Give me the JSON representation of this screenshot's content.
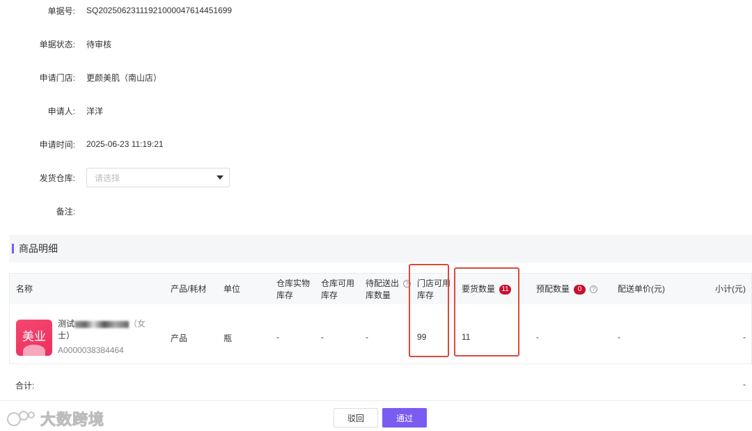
{
  "form": {
    "order_no_label": "单据号:",
    "order_no": "SQ2025062311192100004761445​1699",
    "status_label": "单据状态:",
    "status": "待审核",
    "store_label": "申请门店:",
    "store": "更颜美肌（南山店）",
    "applicant_label": "申请人:",
    "applicant": "洋洋",
    "apply_time_label": "申请时间:",
    "apply_time": "2025-06-23 11:19:21",
    "warehouse_label": "发货仓库:",
    "warehouse_placeholder": "请选择",
    "remark_label": "备注:"
  },
  "section": {
    "title": "商品明细"
  },
  "table": {
    "headers": {
      "name": "名称",
      "type": "产品/耗材",
      "unit": "单位",
      "wh_physical_1": "仓库实物",
      "wh_physical_2": "库存",
      "wh_available_1": "仓库可用",
      "wh_available_2": "库存",
      "pending_1": "待配送出",
      "pending_2": "库数量",
      "store_available_1": "门店可用",
      "store_available_2": "库存",
      "request_qty": "要货数量",
      "request_qty_badge": "11",
      "prealloc_qty": "预配数量",
      "prealloc_badge": "0",
      "unit_price": "配送单价(元)",
      "subtotal": "小计(元)"
    },
    "rows": [
      {
        "thumb_text": "美业",
        "name_prefix": "测试",
        "name_suffix": "（女",
        "name_line2": "士）",
        "code": "A0000038384464",
        "type": "产品",
        "unit": "瓶",
        "wh_physical": "-",
        "wh_available": "-",
        "pending": "-",
        "store_available": "99",
        "request_qty": "11",
        "prealloc_qty": "-",
        "unit_price": "-",
        "subtotal": "-"
      }
    ]
  },
  "total": {
    "label": "合计:",
    "value": "-"
  },
  "footer": {
    "reject_label": "驳回",
    "pass_label": "通过"
  },
  "watermark": {
    "text": "大数跨境"
  },
  "colors": {
    "accent": "#7b5cf0",
    "badge": "#c8102e",
    "highlight": "#d94a3a"
  }
}
